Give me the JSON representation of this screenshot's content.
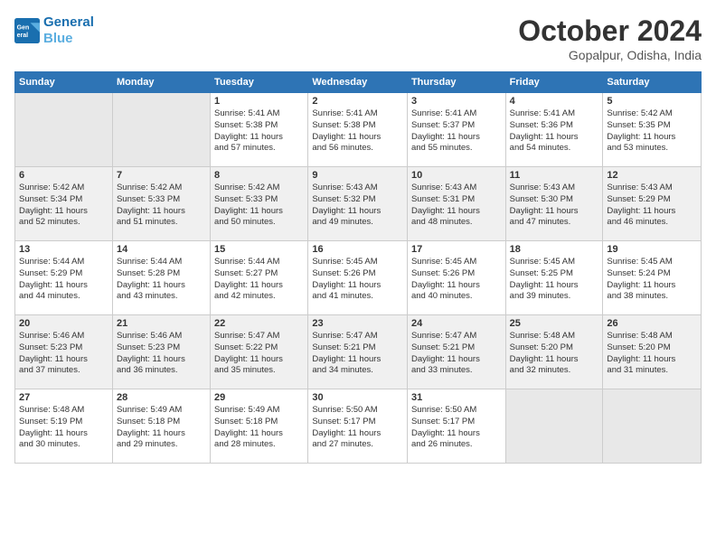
{
  "logo": {
    "line1": "General",
    "line2": "Blue"
  },
  "title": "October 2024",
  "location": "Gopalpur, Odisha, India",
  "weekdays": [
    "Sunday",
    "Monday",
    "Tuesday",
    "Wednesday",
    "Thursday",
    "Friday",
    "Saturday"
  ],
  "weeks": [
    [
      {
        "day": "",
        "info": ""
      },
      {
        "day": "",
        "info": ""
      },
      {
        "day": "1",
        "info": "Sunrise: 5:41 AM\nSunset: 5:38 PM\nDaylight: 11 hours\nand 57 minutes."
      },
      {
        "day": "2",
        "info": "Sunrise: 5:41 AM\nSunset: 5:38 PM\nDaylight: 11 hours\nand 56 minutes."
      },
      {
        "day": "3",
        "info": "Sunrise: 5:41 AM\nSunset: 5:37 PM\nDaylight: 11 hours\nand 55 minutes."
      },
      {
        "day": "4",
        "info": "Sunrise: 5:41 AM\nSunset: 5:36 PM\nDaylight: 11 hours\nand 54 minutes."
      },
      {
        "day": "5",
        "info": "Sunrise: 5:42 AM\nSunset: 5:35 PM\nDaylight: 11 hours\nand 53 minutes."
      }
    ],
    [
      {
        "day": "6",
        "info": "Sunrise: 5:42 AM\nSunset: 5:34 PM\nDaylight: 11 hours\nand 52 minutes."
      },
      {
        "day": "7",
        "info": "Sunrise: 5:42 AM\nSunset: 5:33 PM\nDaylight: 11 hours\nand 51 minutes."
      },
      {
        "day": "8",
        "info": "Sunrise: 5:42 AM\nSunset: 5:33 PM\nDaylight: 11 hours\nand 50 minutes."
      },
      {
        "day": "9",
        "info": "Sunrise: 5:43 AM\nSunset: 5:32 PM\nDaylight: 11 hours\nand 49 minutes."
      },
      {
        "day": "10",
        "info": "Sunrise: 5:43 AM\nSunset: 5:31 PM\nDaylight: 11 hours\nand 48 minutes."
      },
      {
        "day": "11",
        "info": "Sunrise: 5:43 AM\nSunset: 5:30 PM\nDaylight: 11 hours\nand 47 minutes."
      },
      {
        "day": "12",
        "info": "Sunrise: 5:43 AM\nSunset: 5:29 PM\nDaylight: 11 hours\nand 46 minutes."
      }
    ],
    [
      {
        "day": "13",
        "info": "Sunrise: 5:44 AM\nSunset: 5:29 PM\nDaylight: 11 hours\nand 44 minutes."
      },
      {
        "day": "14",
        "info": "Sunrise: 5:44 AM\nSunset: 5:28 PM\nDaylight: 11 hours\nand 43 minutes."
      },
      {
        "day": "15",
        "info": "Sunrise: 5:44 AM\nSunset: 5:27 PM\nDaylight: 11 hours\nand 42 minutes."
      },
      {
        "day": "16",
        "info": "Sunrise: 5:45 AM\nSunset: 5:26 PM\nDaylight: 11 hours\nand 41 minutes."
      },
      {
        "day": "17",
        "info": "Sunrise: 5:45 AM\nSunset: 5:26 PM\nDaylight: 11 hours\nand 40 minutes."
      },
      {
        "day": "18",
        "info": "Sunrise: 5:45 AM\nSunset: 5:25 PM\nDaylight: 11 hours\nand 39 minutes."
      },
      {
        "day": "19",
        "info": "Sunrise: 5:45 AM\nSunset: 5:24 PM\nDaylight: 11 hours\nand 38 minutes."
      }
    ],
    [
      {
        "day": "20",
        "info": "Sunrise: 5:46 AM\nSunset: 5:23 PM\nDaylight: 11 hours\nand 37 minutes."
      },
      {
        "day": "21",
        "info": "Sunrise: 5:46 AM\nSunset: 5:23 PM\nDaylight: 11 hours\nand 36 minutes."
      },
      {
        "day": "22",
        "info": "Sunrise: 5:47 AM\nSunset: 5:22 PM\nDaylight: 11 hours\nand 35 minutes."
      },
      {
        "day": "23",
        "info": "Sunrise: 5:47 AM\nSunset: 5:21 PM\nDaylight: 11 hours\nand 34 minutes."
      },
      {
        "day": "24",
        "info": "Sunrise: 5:47 AM\nSunset: 5:21 PM\nDaylight: 11 hours\nand 33 minutes."
      },
      {
        "day": "25",
        "info": "Sunrise: 5:48 AM\nSunset: 5:20 PM\nDaylight: 11 hours\nand 32 minutes."
      },
      {
        "day": "26",
        "info": "Sunrise: 5:48 AM\nSunset: 5:20 PM\nDaylight: 11 hours\nand 31 minutes."
      }
    ],
    [
      {
        "day": "27",
        "info": "Sunrise: 5:48 AM\nSunset: 5:19 PM\nDaylight: 11 hours\nand 30 minutes."
      },
      {
        "day": "28",
        "info": "Sunrise: 5:49 AM\nSunset: 5:18 PM\nDaylight: 11 hours\nand 29 minutes."
      },
      {
        "day": "29",
        "info": "Sunrise: 5:49 AM\nSunset: 5:18 PM\nDaylight: 11 hours\nand 28 minutes."
      },
      {
        "day": "30",
        "info": "Sunrise: 5:50 AM\nSunset: 5:17 PM\nDaylight: 11 hours\nand 27 minutes."
      },
      {
        "day": "31",
        "info": "Sunrise: 5:50 AM\nSunset: 5:17 PM\nDaylight: 11 hours\nand 26 minutes."
      },
      {
        "day": "",
        "info": ""
      },
      {
        "day": "",
        "info": ""
      }
    ]
  ]
}
